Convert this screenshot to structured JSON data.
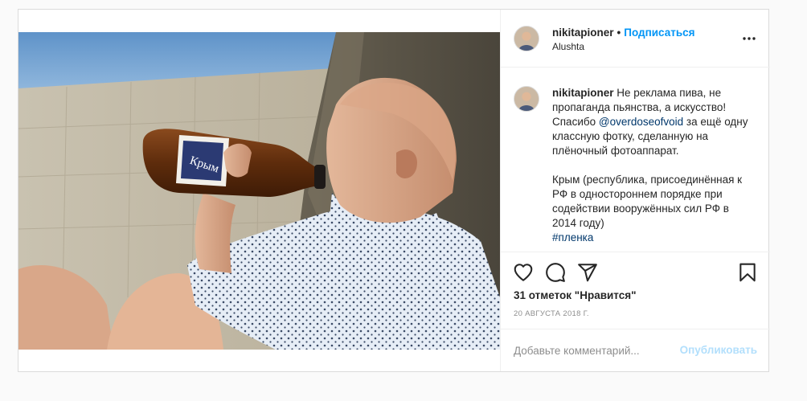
{
  "post": {
    "username": "nikitapioner",
    "separator": "•",
    "follow_label": "Подписаться",
    "location": "Alushta",
    "more_icon": "more-horizontal-icon",
    "photo": {
      "bottle_label": "Крым"
    },
    "caption": {
      "username": "nikitapioner",
      "text_1": "Не реклама пива, не пропаганда пьянства, а искусство! Спасибо ",
      "mention": "@overdoseofvoid",
      "text_2": " за ещё одну классную фотку, сделанную на плёночный фотоаппарат.",
      "text_3": "Крым (республика, присоединённая к РФ в одностороннем порядке при содействии вооружённых сил РФ в 2014 году)",
      "hashtag": "#пленка"
    },
    "actions": {
      "like_icon": "heart-icon",
      "comment_icon": "comment-bubble-icon",
      "share_icon": "paper-plane-icon",
      "save_icon": "bookmark-icon"
    },
    "likes": "31 отметок \"Нравится\"",
    "date": "20 АВГУСТА 2018 Г.",
    "comment": {
      "placeholder": "Добавьте комментарий...",
      "value": "",
      "publish_label": "Опубликовать"
    },
    "colors": {
      "accent": "#0095f6",
      "publish_disabled": "#b2dffc",
      "link": "#00376b",
      "muted": "#8e8e8e",
      "border": "#dbdbdb"
    }
  }
}
